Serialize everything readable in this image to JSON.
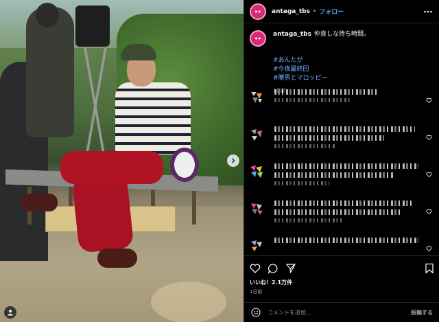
{
  "post": {
    "username": "antaga_tbs",
    "follow_label": "フォロー",
    "caption_text": "仲良しな待ち時間。",
    "hashtags": [
      "#あんたが",
      "#今夜最終回",
      "#勝男とマロッピー"
    ],
    "caption_time": "1日前",
    "likes": "いいね！2.1万件",
    "post_time": "1日前"
  },
  "comment_input": {
    "placeholder": "コメントを追加...",
    "post_label": "投稿する"
  },
  "colors": {
    "link_blue": "#4aa6f0",
    "hashtag_blue": "#78b0ff",
    "avatar_pink": "#d9287a",
    "background": "#000000"
  },
  "icons": [
    "user-tag-icon",
    "next-arrow-icon",
    "more-options-icon",
    "heart-icon",
    "comment-icon",
    "share-icon",
    "bookmark-icon",
    "emoji-icon"
  ]
}
